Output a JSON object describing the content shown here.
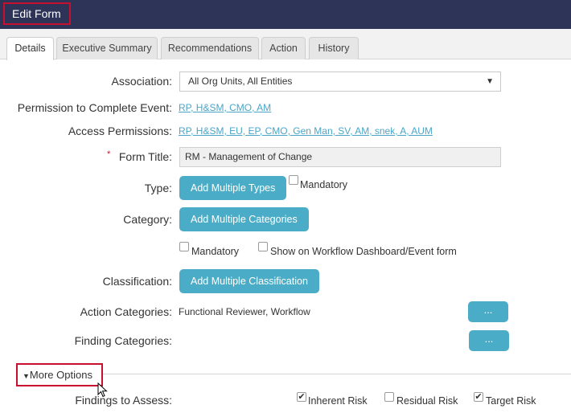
{
  "window": {
    "title": "Edit Form"
  },
  "tabs": [
    {
      "label": "Details",
      "active": true
    },
    {
      "label": "Executive Summary"
    },
    {
      "label": "Recommendations"
    },
    {
      "label": "Action"
    },
    {
      "label": "History"
    }
  ],
  "form": {
    "association": {
      "label": "Association:",
      "value": "All Org Units, All Entities"
    },
    "permission_complete": {
      "label": "Permission to Complete Event:",
      "value": "RP, H&SM, CMO, AM"
    },
    "access_permissions": {
      "label": "Access Permissions:",
      "value": "RP, H&SM, EU, EP, CMO, Gen Man, SV, AM, snek, A, AUM"
    },
    "form_title": {
      "required_mark": "*",
      "label": "Form Title:",
      "value": "RM - Management of Change"
    },
    "type": {
      "label": "Type:",
      "button": "Add Multiple Types",
      "mandatory_label": "Mandatory",
      "mandatory_checked": false
    },
    "category": {
      "label": "Category:",
      "button": "Add Multiple Categories",
      "mandatory_label": "Mandatory",
      "mandatory_checked": false,
      "show_label": "Show on Workflow Dashboard/Event form",
      "show_checked": false
    },
    "classification": {
      "label": "Classification:",
      "button": "Add Multiple Classification"
    },
    "action_categories": {
      "label": "Action Categories:",
      "value": "Functional Reviewer, Workflow",
      "button": "..."
    },
    "finding_categories": {
      "label": "Finding Categories:",
      "button": "..."
    },
    "more_options": {
      "label": "More Options",
      "icon": "caret-down-icon"
    },
    "findings_to_assess": {
      "label": "Findings to Assess:",
      "options": [
        {
          "label": "Inherent Risk",
          "checked": true
        },
        {
          "label": "Residual Risk",
          "checked": false
        },
        {
          "label": "Target Risk",
          "checked": true
        }
      ]
    }
  },
  "colors": {
    "header": "#2e3358",
    "accent": "#4aacc6",
    "highlight": "#c8102e",
    "link": "#4aa5c7"
  }
}
